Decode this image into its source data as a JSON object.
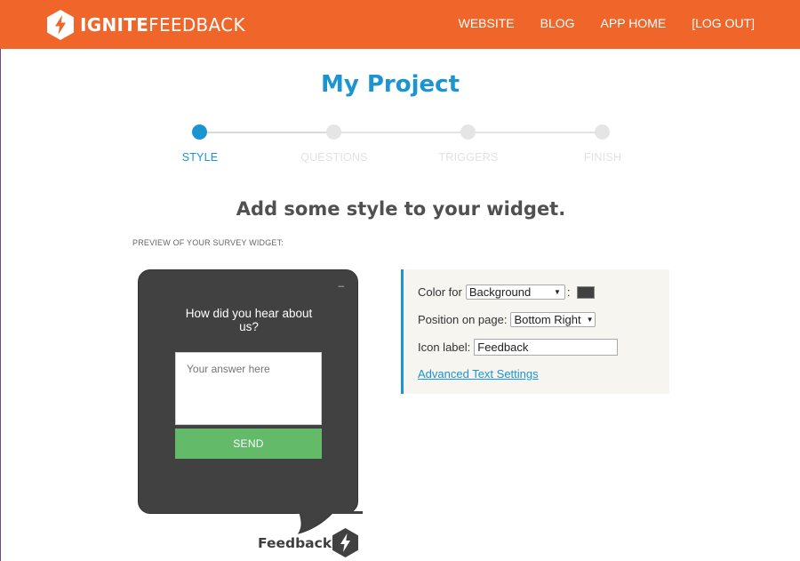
{
  "brand": {
    "name_bold": "IGNITE",
    "name_light": "FEEDBACK",
    "primary_color": "#ef652a",
    "accent_color": "#1b95d1"
  },
  "nav": {
    "items": [
      "WEBSITE",
      "BLOG",
      "APP HOME",
      "[LOG OUT]"
    ]
  },
  "page": {
    "title": "My Project",
    "subheading": "Add some style to your widget.",
    "preview_caption": "PREVIEW OF YOUR SURVEY WIDGET:"
  },
  "stepper": {
    "steps": [
      "STYLE",
      "QUESTIONS",
      "TRIGGERS",
      "FINISH"
    ],
    "active_index": 0
  },
  "widget": {
    "minimize_glyph": "–",
    "question": "How did you hear about us?",
    "answer_placeholder": "Your answer here",
    "send_label": "SEND",
    "tab_label": "Feedback",
    "background_color": "#414141",
    "send_color": "#63bb6a"
  },
  "settings": {
    "color_label": "Color for",
    "color_target": "Background",
    "color_suffix": ":",
    "position_label": "Position on page:",
    "position_value": "Bottom Right",
    "icon_label": "Icon label:",
    "icon_value": "Feedback",
    "advanced_link": "Advanced Text Settings"
  }
}
